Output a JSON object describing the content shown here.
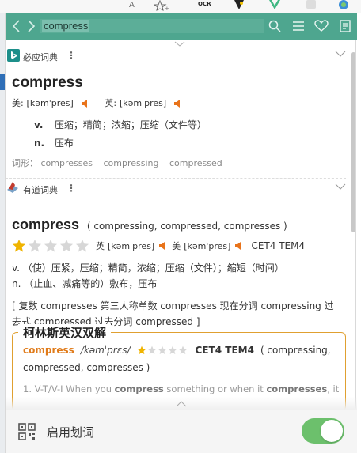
{
  "browser": {
    "reader_label": "A",
    "ext_labels": [
      "OCR"
    ]
  },
  "search": {
    "query": "compress"
  },
  "bing": {
    "title": "必应词典",
    "word": "compress",
    "us_label": "美:",
    "us_phonetic": "[kəmˈpres]",
    "uk_label": "英:",
    "uk_phonetic": "[kəmˈpres]",
    "defs": [
      {
        "pos": "v.",
        "text": "压缩；精简；浓缩；压缩（文件等）"
      },
      {
        "pos": "n.",
        "text": "压布"
      }
    ],
    "forms_label": "词形：",
    "forms": [
      "compresses",
      "compressing",
      "compressed"
    ]
  },
  "youdao": {
    "title": "有道词典",
    "word": "compress",
    "inflections": "( compressing, compressed, compresses )",
    "rating": 1,
    "rating_max": 5,
    "uk_label": "英",
    "uk_phonetic": "[kəmˈpres]",
    "us_label": "美",
    "us_phonetic": "[kəmˈpres]",
    "exam": "CET4 TEM4",
    "defs": [
      "v. （使）压紧，压缩；精简，浓缩；压缩（文件）；缩短（时间）",
      "n. （止血、减痛等的）敷布，压布"
    ],
    "note_line1": "[ 复数 compresses 第三人称单数 compresses 现在分词 compressing 过",
    "note_line2": "去式 compressed 过去分词 compressed ]",
    "collins": {
      "title": "柯林斯英汉双解",
      "word": "compress",
      "phonetic": "/kəmˈprɛs/",
      "rating": 1,
      "rating_max": 5,
      "exam": "CET4 TEM4",
      "forms_line1": "( compressing,",
      "forms_line2": "compressed, compresses )",
      "example": "1. V-T/V-I When you compress something or when it compresses, it"
    }
  },
  "footer": {
    "toggle_label": "启用划词",
    "toggle_on": true
  },
  "colors": {
    "accent": "#4ea68f",
    "word_orange": "#e07b1a",
    "speaker": "#e8731a",
    "star_on": "#f0b400",
    "star_off": "#d7d7d7",
    "toggle": "#6cc06c"
  }
}
